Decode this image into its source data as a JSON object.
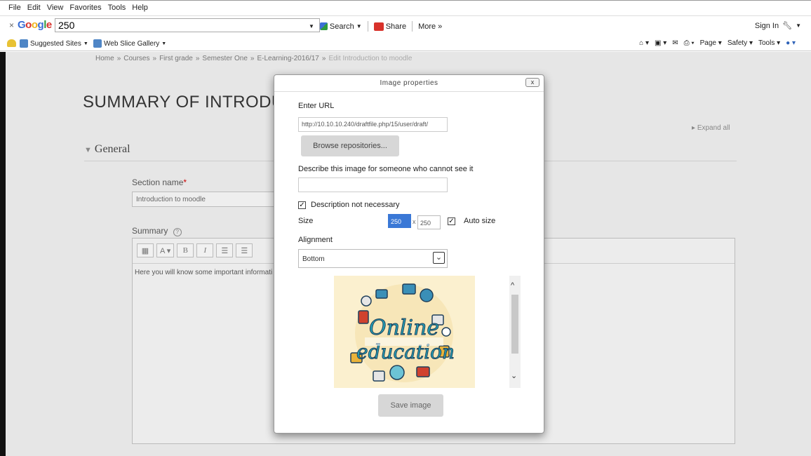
{
  "menubar": {
    "items": [
      "File",
      "Edit",
      "View",
      "Favorites",
      "Tools",
      "Help"
    ]
  },
  "googlebar": {
    "logo": "Google",
    "search_value": "250",
    "search_label": "Search",
    "share_label": "Share",
    "more_label": "More »",
    "signin_label": "Sign In"
  },
  "favbar": {
    "suggested": "Suggested Sites",
    "webslice": "Web Slice Gallery",
    "page": "Page",
    "safety": "Safety",
    "tools": "Tools"
  },
  "breadcrumb": [
    "Home",
    "»",
    "Courses",
    "»",
    "First grade",
    "»",
    "Semester One",
    "»",
    "E-Learning-2016/17",
    "»",
    "Edit Introduction to moodle"
  ],
  "page": {
    "title": "SUMMARY OF INTRODUCT",
    "expand_all": "Expand all",
    "general": "General",
    "section_name_label": "Section name",
    "section_name_value": "Introduction to moodle",
    "summary_label": "Summary",
    "editor_content": "Here you will know some important informati"
  },
  "dialog": {
    "title": "Image properties",
    "close": "x",
    "enter_url_label": "Enter URL",
    "url_value": "http://10.10.10.240/draftfile.php/15/user/draft/",
    "browse_label": "Browse repositories...",
    "describe_label": "Describe this image for someone who cannot see it",
    "describe_value": "",
    "desc_not_necessary_label": "Description not necessary",
    "size_label": "Size",
    "width_value": "250",
    "size_sep": "x",
    "height_value": "250",
    "auto_size_label": "Auto size",
    "alignment_label": "Alignment",
    "alignment_value": "Bottom",
    "save_label": "Save image"
  }
}
